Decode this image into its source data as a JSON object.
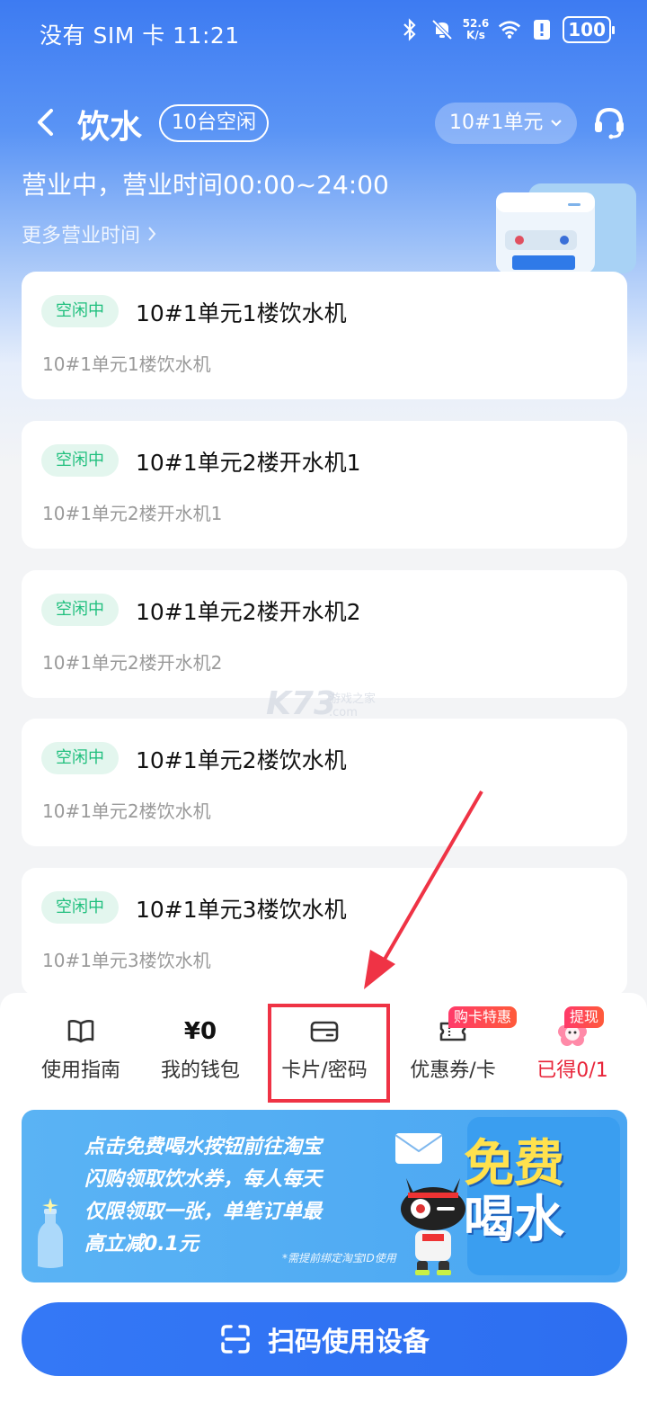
{
  "status_bar": {
    "left": "没有 SIM 卡 11:21",
    "speed_value": "52.6",
    "speed_unit": "K/s",
    "battery": "100"
  },
  "header": {
    "title": "饮水",
    "idle_badge": "10台空闲",
    "unit_selector": "10#1单元"
  },
  "business": {
    "hours": "营业中，营业时间00:00~24:00",
    "more_hours": "更多营业时间"
  },
  "devices": [
    {
      "status": "空闲中",
      "name": "10#1单元1楼饮水机",
      "sub": "10#1单元1楼饮水机"
    },
    {
      "status": "空闲中",
      "name": "10#1单元2楼开水机1",
      "sub": "10#1单元2楼开水机1"
    },
    {
      "status": "空闲中",
      "name": "10#1单元2楼开水机2",
      "sub": "10#1单元2楼开水机2"
    },
    {
      "status": "空闲中",
      "name": "10#1单元2楼饮水机",
      "sub": "10#1单元2楼饮水机"
    },
    {
      "status": "空闲中",
      "name": "10#1单元3楼饮水机",
      "sub": "10#1单元3楼饮水机"
    }
  ],
  "watermark": {
    "brand": "K73",
    "caption": "游戏之家",
    "domain": ".com"
  },
  "toolbar": {
    "guide": "使用指南",
    "wallet_amount": "¥0",
    "wallet": "我的钱包",
    "card": "卡片/密码",
    "coupon": "优惠券/卡",
    "coupon_badge": "购卡特惠",
    "earned": "已得0/1",
    "earned_badge": "提现"
  },
  "promo": {
    "line1": "点击免费喝水按钮前往淘宝",
    "line2": "闪购领取饮水券，每人每天",
    "line3": "仅限领取一张，单笔订单最",
    "line4": "高立减0.1元",
    "note": "*需提前绑定淘宝ID使用",
    "big1": "免费",
    "big2": "喝水"
  },
  "scan_button": "扫码使用设备",
  "colors": {
    "primary": "#3478f6",
    "idle_green": "#1fbf7d",
    "highlight_red": "#ef3345"
  }
}
